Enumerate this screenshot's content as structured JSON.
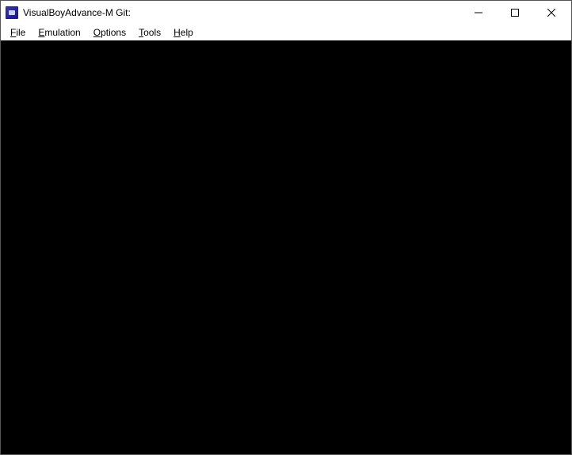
{
  "window": {
    "title": "VisualBoyAdvance-M Git:"
  },
  "menu": {
    "items": [
      {
        "label": "File",
        "mnemonic_index": 0
      },
      {
        "label": "Emulation",
        "mnemonic_index": 0
      },
      {
        "label": "Options",
        "mnemonic_index": 0
      },
      {
        "label": "Tools",
        "mnemonic_index": 0
      },
      {
        "label": "Help",
        "mnemonic_index": 0
      }
    ]
  }
}
